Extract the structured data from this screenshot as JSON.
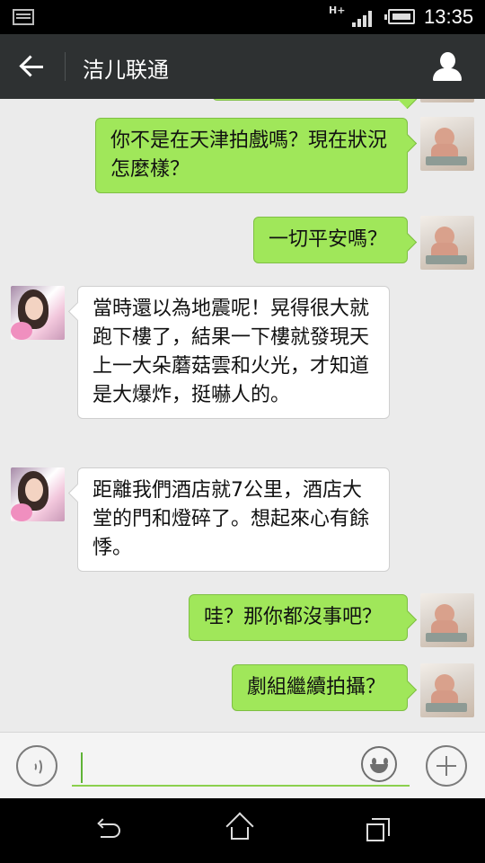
{
  "status_bar": {
    "time": "13:35",
    "network_label": "H+",
    "icons": [
      "notification-icon",
      "network-type-icon",
      "signal-icon",
      "battery-icon"
    ]
  },
  "header": {
    "title": "洁儿联通",
    "back_icon": "arrow-left-icon",
    "profile_icon": "person-icon"
  },
  "messages": [
    {
      "side": "out",
      "text": "你不是在天津拍戲嗎？現在狀況怎麼樣？"
    },
    {
      "side": "out",
      "text": "一切平安嗎？"
    },
    {
      "side": "in",
      "text": "當時還以為地震呢！晃得很大就跑下樓了，結果一下樓就發現天上一大朵蘑菇雲和火光，才知道是大爆炸，挺嚇人的。"
    },
    {
      "side": "in",
      "text": "距離我們酒店就7公里，酒店大堂的門和燈碎了。想起來心有餘悸。"
    },
    {
      "side": "out",
      "text": "哇？那你都沒事吧？"
    },
    {
      "side": "out",
      "text": "劇組繼續拍攝？"
    }
  ],
  "input_bar": {
    "voice_icon": "voice-icon",
    "text_value": "",
    "emoji_icon": "emoji-icon",
    "plus_icon": "plus-icon"
  },
  "nav_bar": {
    "icons": [
      "nav-back-icon",
      "nav-home-icon",
      "nav-recent-icon"
    ]
  },
  "colors": {
    "outgoing_bubble": "#a0e75a",
    "incoming_bubble": "#ffffff",
    "header_bg": "#2e3132",
    "chat_bg": "#ebebeb"
  }
}
